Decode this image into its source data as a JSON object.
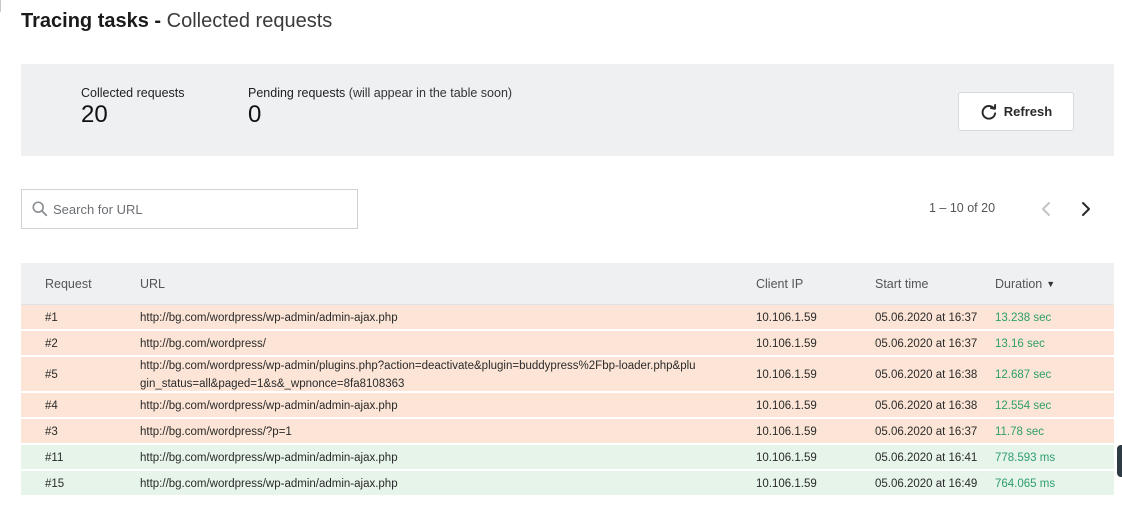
{
  "header": {
    "title_bold": "Tracing tasks -",
    "title_rest": "Collected requests"
  },
  "summary": {
    "collected_label": "Collected requests",
    "collected_value": "20",
    "pending_label": "Pending requests",
    "pending_note": "(will appear in the table soon)",
    "pending_value": "0",
    "refresh_label": "Refresh"
  },
  "search": {
    "placeholder": "Search for URL"
  },
  "pagination": {
    "range_text": "1 – 10 of 20"
  },
  "table": {
    "columns": {
      "request": "Request",
      "url": "URL",
      "client_ip": "Client IP",
      "start_time": "Start time",
      "duration": "Duration"
    },
    "rows": [
      {
        "request": "#1",
        "url": "http://bg.com/wordpress/wp-admin/admin-ajax.php",
        "client_ip": "10.106.1.59",
        "start_time": "05.06.2020 at 16:37",
        "duration": "13.238 sec",
        "status": "slow"
      },
      {
        "request": "#2",
        "url": "http://bg.com/wordpress/",
        "client_ip": "10.106.1.59",
        "start_time": "05.06.2020 at 16:37",
        "duration": "13.16 sec",
        "status": "slow"
      },
      {
        "request": "#5",
        "url": "http://bg.com/wordpress/wp-admin/plugins.php?action=deactivate&plugin=buddypress%2Fbp-loader.php&plugin_status=all&paged=1&s&_wpnonce=8fa8108363",
        "client_ip": "10.106.1.59",
        "start_time": "05.06.2020 at 16:38",
        "duration": "12.687 sec",
        "status": "slow"
      },
      {
        "request": "#4",
        "url": "http://bg.com/wordpress/wp-admin/admin-ajax.php",
        "client_ip": "10.106.1.59",
        "start_time": "05.06.2020 at 16:38",
        "duration": "12.554 sec",
        "status": "slow"
      },
      {
        "request": "#3",
        "url": "http://bg.com/wordpress/?p=1",
        "client_ip": "10.106.1.59",
        "start_time": "05.06.2020 at 16:37",
        "duration": "11.78 sec",
        "status": "slow"
      },
      {
        "request": "#11",
        "url": "http://bg.com/wordpress/wp-admin/admin-ajax.php",
        "client_ip": "10.106.1.59",
        "start_time": "05.06.2020 at 16:41",
        "duration": "778.593 ms",
        "status": "fast"
      },
      {
        "request": "#15",
        "url": "http://bg.com/wordpress/wp-admin/admin-ajax.php",
        "client_ip": "10.106.1.59",
        "start_time": "05.06.2020 at 16:49",
        "duration": "764.065 ms",
        "status": "fast"
      }
    ]
  },
  "colors": {
    "slow_row": "#fce5d6",
    "fast_row": "#e6f4ea",
    "duration_text": "#2e9e6a",
    "panel_bg": "#eef0f2"
  },
  "icons": {
    "refresh": "refresh-icon",
    "search": "search-icon",
    "prev": "chevron-left-icon",
    "next": "chevron-right-icon",
    "sort": "caret-down-icon"
  }
}
